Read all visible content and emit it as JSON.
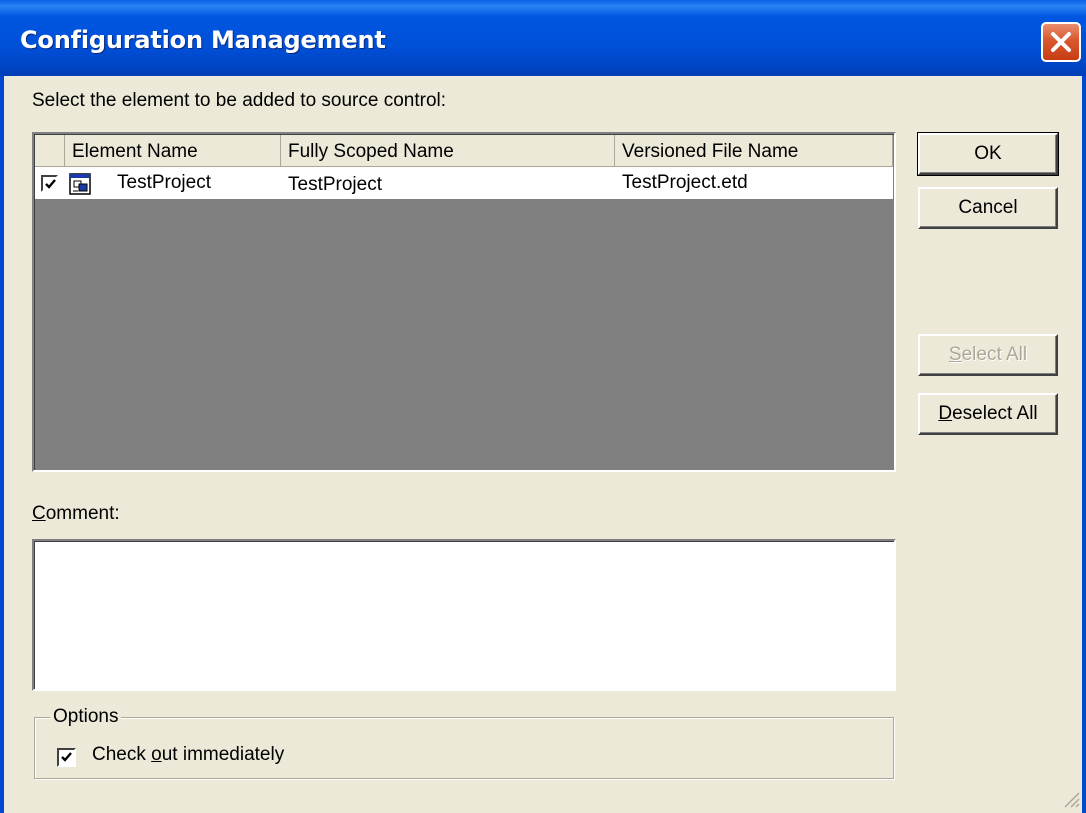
{
  "window": {
    "title": "Configuration Management",
    "close_icon": "close-icon"
  },
  "instruction": "Select the element to be added to source control:",
  "list": {
    "columns": [
      "Element Name",
      "Fully Scoped Name",
      "Versioned File Name"
    ],
    "rows": [
      {
        "checked": true,
        "icon": "project-icon",
        "element_name": "TestProject",
        "fully_scoped_name": "TestProject",
        "versioned_file_name": "TestProject.etd"
      }
    ]
  },
  "buttons": {
    "ok": "OK",
    "cancel": "Cancel",
    "select_all": {
      "mnemonic": "S",
      "rest": "elect All",
      "enabled": false
    },
    "deselect_all": {
      "mnemonic": "D",
      "rest": "eselect All",
      "enabled": true
    }
  },
  "comment": {
    "label_mnemonic": "C",
    "label_rest": "omment:",
    "value": ""
  },
  "options": {
    "legend": "Options",
    "check_out": {
      "before": "Check ",
      "mnemonic": "o",
      "after": "ut immediately",
      "checked": true
    }
  },
  "colors": {
    "titlebar": "#0050d8",
    "dialog_bg": "#ece9d8",
    "list_empty_bg": "#808080",
    "close_button": "#d8582e"
  }
}
